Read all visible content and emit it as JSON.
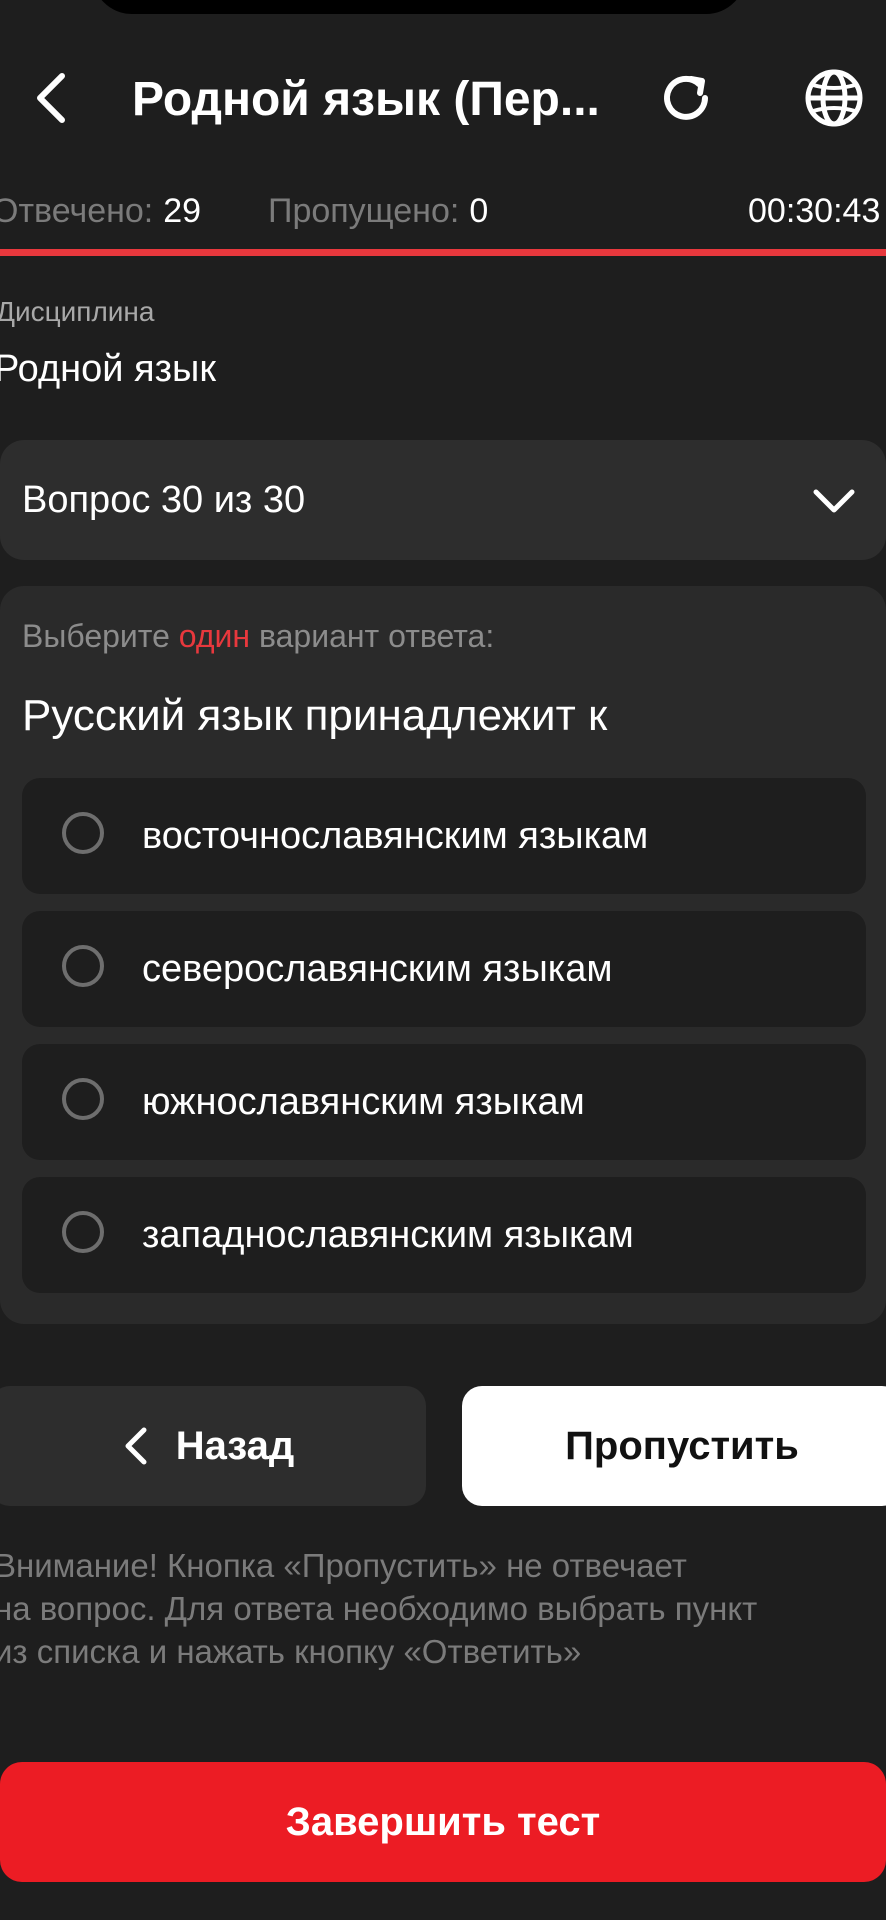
{
  "header": {
    "title": "Родной язык (Пер...",
    "back_icon": "chevron-left-icon",
    "refresh_icon": "refresh-icon",
    "language_icon": "globe-icon"
  },
  "stats": {
    "answered_label": "Отвечено:",
    "answered_value": "29",
    "skipped_label": "Пропущено:",
    "skipped_value": "0",
    "timer": "00:30:43",
    "progress_fraction": 1.0
  },
  "discipline": {
    "label": "Дисциплина",
    "value": "Родной язык"
  },
  "question_selector": {
    "label": "Вопрос 30 из 30",
    "icon": "chevron-down-icon"
  },
  "question": {
    "instruction_before": "Выберите",
    "instruction_highlight": "один",
    "instruction_after": "вариант ответа:",
    "text": "Русский язык принадлежит к",
    "options": [
      {
        "label": "восточнославянским языкам",
        "selected": false
      },
      {
        "label": "северославянским языкам",
        "selected": false
      },
      {
        "label": "южнославянским языкам",
        "selected": false
      },
      {
        "label": "западнославянским языкам",
        "selected": false
      }
    ]
  },
  "actions": {
    "back_label": "Назад",
    "skip_label": "Пропустить",
    "finish_label": "Завершить тест"
  },
  "warning": {
    "line1": "Внимание! Кнопка «Пропустить» не отвечает",
    "line2": "на вопрос. Для ответа необходимо выбрать пункт",
    "line3": "из списка и нажать кнопку «Ответить»"
  },
  "colors": {
    "background": "#1e1e1e",
    "accent": "#ec1c24",
    "progress": "#e8383d",
    "muted_text": "#7b7b7b"
  }
}
